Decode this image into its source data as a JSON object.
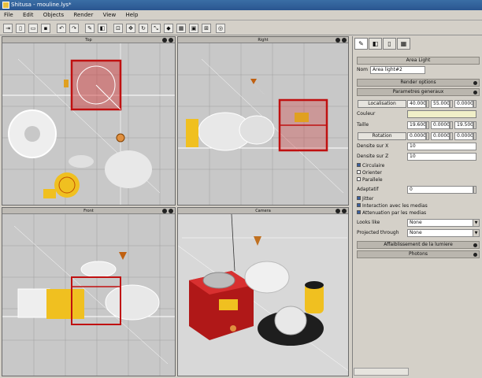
{
  "window": {
    "title": "Shitusa - mouline.lys*"
  },
  "menu": [
    "File",
    "Edit",
    "Objects",
    "Render",
    "View",
    "Help"
  ],
  "viewports": {
    "top": "Top",
    "right": "Right",
    "front": "Front",
    "camera": "Camera"
  },
  "panel": {
    "header": "Area Light",
    "name_label": "Nom",
    "name_value": "Area light#2",
    "sections": {
      "render_options": "Render options",
      "general": "Parametres generaux",
      "attenuation": "Affaiblissement de la lumiere",
      "photons": "Photons"
    },
    "localisation": {
      "label": "Localisation",
      "x": "40.000",
      "y": "55.000",
      "z": "0.0000"
    },
    "couleur_label": "Couleur",
    "taille": {
      "label": "Taille",
      "x": "19.600",
      "y": "0.0000",
      "z": "19.500"
    },
    "rotation": {
      "label": "Rotation",
      "x": "0.0000",
      "y": "0.0000",
      "z": "0.0000"
    },
    "densite_x": {
      "label": "Densite sur X",
      "value": "10"
    },
    "densite_z": {
      "label": "Densite sur Z",
      "value": "10"
    },
    "circulaire": "Circulaire",
    "orienter": "Orienter",
    "parallele": "Parallele",
    "adaptatif": {
      "label": "Adaptatif",
      "value": "0"
    },
    "jitter": "Jitter",
    "interaction": "Interaction avec les medias",
    "attenuation_medias": "Attenuation par les medias",
    "looks_like": {
      "label": "Looks like",
      "value": "None"
    },
    "projected": {
      "label": "Projected through",
      "value": "None"
    }
  },
  "colors": {
    "accent": "#3a6ea5",
    "wire": "#ffffff",
    "selected": "#d02020",
    "yellow": "#f0c020"
  }
}
